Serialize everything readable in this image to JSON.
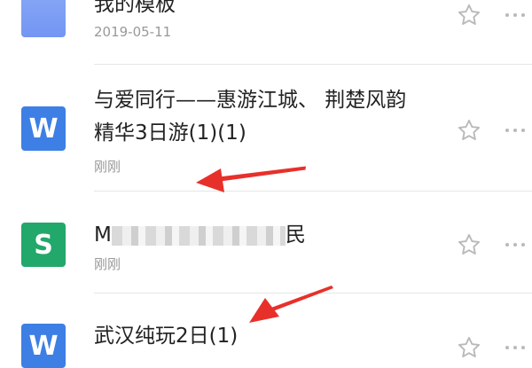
{
  "files": [
    {
      "icon": "folder-icon",
      "title": "我的模板",
      "date": "2019-05-11"
    },
    {
      "icon": "word-doc-icon",
      "icon_letter": "W",
      "title_line1": "与爱同行——惠游江城、 荆楚风韵",
      "title_line2": "精华3日游(1)(1)",
      "date": "刚刚"
    },
    {
      "icon": "sheet-doc-icon",
      "icon_letter": "S",
      "title_start": "M",
      "title_end": "民",
      "date": "刚刚"
    },
    {
      "icon": "word-doc-icon",
      "icon_letter": "W",
      "title": "武汉纯玩2日(1)"
    }
  ],
  "colors": {
    "word": "#3d7fe4",
    "sheet": "#22a86a",
    "folder": "#7396f3",
    "annotation_arrow": "#e8302a"
  }
}
